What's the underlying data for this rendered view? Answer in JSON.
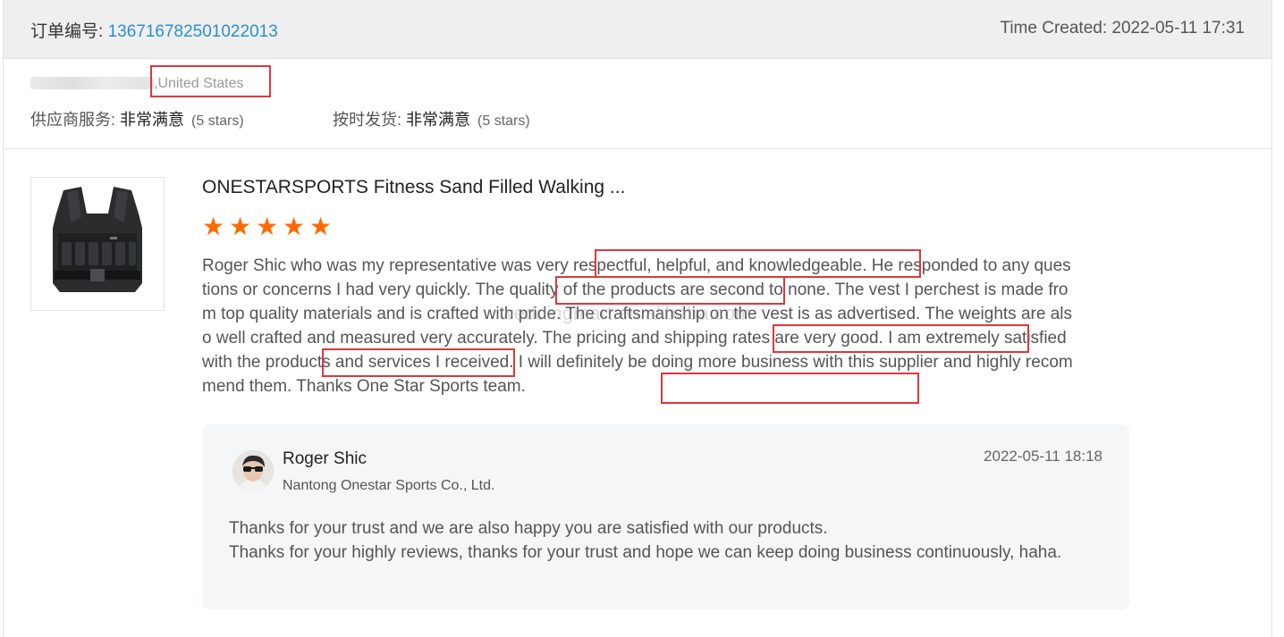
{
  "order": {
    "label": "订单编号: ",
    "number": "136716782501022013",
    "time_created": "Time Created: 2022-05-11 17:31"
  },
  "buyer": {
    "country": ",United States"
  },
  "ratings": [
    {
      "name": "供应商服务: ",
      "value": "非常满意",
      "stars": "(5 stars)"
    },
    {
      "name": "按时发货: ",
      "value": "非常满意",
      "stars": "(5 stars)"
    }
  ],
  "product": {
    "title": "ONESTARSPORTS Fitness Sand Filled Walking ...",
    "star_count": 5,
    "star_color": "#ff6a00",
    "image_icon": "weighted-vest-icon"
  },
  "review": {
    "segments": [
      "Roger Shic who was my representative was very ",
      "respectful, helpful, and knowledgeable.",
      " He responded to any questions or concerns I had very quickly. ",
      "The quality of the products",
      " are second to none. The vest I perchest is made from top quality materials and is crafted with pride. The craftsmanship on the vest is as advertised. The weights are also well crafted and measured very accurately. ",
      "The pricing and shipping rates",
      " are very good. I am ",
      "extremely satisfied with",
      " the products and services I received. I will definitely be doing more business with this supplier and highly recommend them. ",
      "Thanks One Star Sports team."
    ],
    "watermark": "weddingmart.en.alibaba.com"
  },
  "reply": {
    "name": "Roger Shic",
    "company": "Nantong Onestar Sports Co., Ltd.",
    "time": "2022-05-11 18:18",
    "line1": "Thanks for your trust and we are also happy you are satisfied with our products.",
    "line2": "Thanks for your highly reviews, thanks for your trust and hope we can keep doing business continuously, haha."
  },
  "colors": {
    "link": "#2a8fd0",
    "highlight_box": "#d9393e",
    "header_bg": "#efefef",
    "reply_bg": "#f5f6f8"
  }
}
